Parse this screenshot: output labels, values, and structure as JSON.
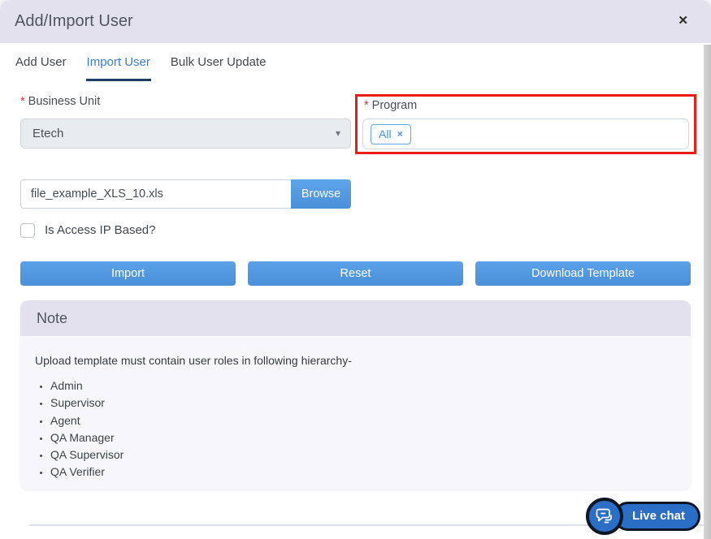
{
  "colors": {
    "header_bg": "#e3e1ed",
    "accent_blue": "#4a90d9",
    "active_tab_blue": "#3b7ed7",
    "tab_underline_navy": "#1d3c5f",
    "required_red": "#e0312b",
    "highlight_red_border": "#ea1c16",
    "note_body_bg": "#f7f6fa",
    "live_chat_blue": "#2b6ec5"
  },
  "modal": {
    "title": "Add/Import User",
    "close_icon": "✕"
  },
  "tabs": [
    {
      "label": "Add User"
    },
    {
      "label": "Import User"
    },
    {
      "label": "Bulk User Update"
    }
  ],
  "form": {
    "business_unit": {
      "required_marker": "*",
      "label": "Business Unit",
      "value": "Etech",
      "caret_icon": "▾"
    },
    "program": {
      "required_marker": "*",
      "label": "Program",
      "chip": {
        "label": "All",
        "remove_icon": "×"
      }
    },
    "file_upload": {
      "filename": "file_example_XLS_10.xls",
      "browse_label": "Browse"
    },
    "ip_checkbox": {
      "label": "Is Access IP Based?",
      "checked": false
    },
    "actions": [
      {
        "label": "Import"
      },
      {
        "label": "Reset"
      },
      {
        "label": "Download Template"
      }
    ]
  },
  "note": {
    "title": "Note",
    "intro": "Upload template must contain user roles in following hierarchy-",
    "roles": [
      "Admin",
      "Supervisor",
      "Agent",
      "QA Manager",
      "QA Supervisor",
      "QA Verifier"
    ]
  },
  "live_chat": {
    "label": "Live chat"
  }
}
